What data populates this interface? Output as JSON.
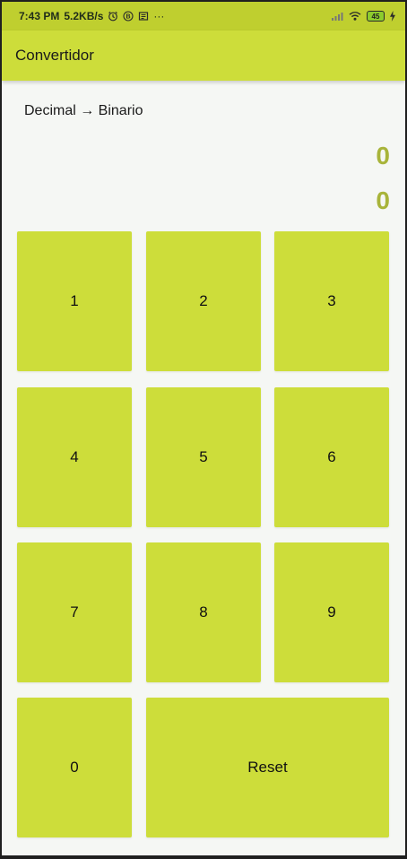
{
  "status_bar": {
    "time": "7:43 PM",
    "network_speed": "5.2KB/s",
    "more": "···",
    "battery_level": "45",
    "icons": [
      "alarm-icon",
      "b-icon",
      "notification-icon",
      "more-icon",
      "signal-icon",
      "wifi-icon",
      "battery-icon",
      "charging-icon"
    ]
  },
  "app_bar": {
    "title": "Convertidor"
  },
  "converter": {
    "mode_label": "Decimal → Binario",
    "decimal_value": "0",
    "binary_value": "0"
  },
  "keypad": {
    "keys": [
      "1",
      "2",
      "3",
      "4",
      "5",
      "6",
      "7",
      "8",
      "9",
      "0"
    ],
    "reset_label": "Reset"
  },
  "colors": {
    "accent": "#cddd3a",
    "status_bar": "#bfcf2f",
    "result_text": "#a8b43a",
    "background": "#f5f7f4"
  }
}
